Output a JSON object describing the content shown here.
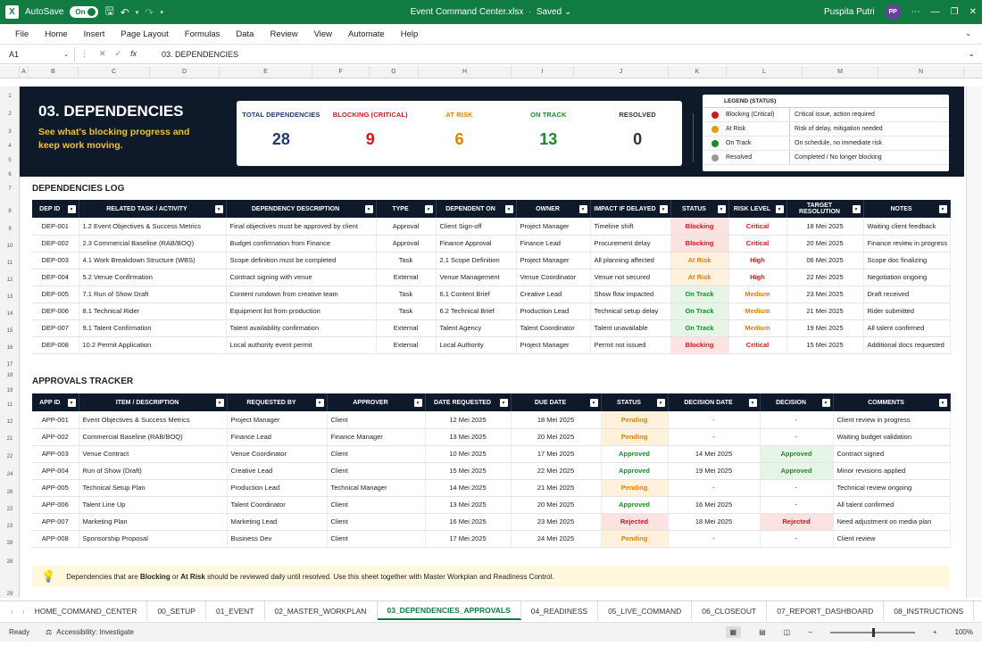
{
  "title_bar": {
    "autosave": "AutoSave",
    "toggle": "On",
    "filename": "Event Command Center.xlsx",
    "saved": "Saved",
    "user": "Puspita Putri",
    "initials": "PP"
  },
  "menu": [
    "File",
    "Home",
    "Insert",
    "Page Layout",
    "Formulas",
    "Data",
    "Review",
    "View",
    "Automate",
    "Help"
  ],
  "formula": {
    "cell": "A1",
    "value": "03. DEPENDENCIES"
  },
  "columns": [
    "A",
    "B",
    "C",
    "D",
    "E",
    "F",
    "G",
    "H",
    "I",
    "J",
    "K",
    "L",
    "M",
    "N"
  ],
  "rows": [
    "1",
    "2",
    "3",
    "4",
    "5",
    "6",
    "7",
    "8",
    "9",
    "10",
    "11",
    "12",
    "13",
    "14",
    "15",
    "16",
    "17",
    "18",
    "19",
    "11",
    "12",
    "21",
    "22",
    "24",
    "26",
    "22",
    "23",
    "28",
    "28",
    "29"
  ],
  "banner": {
    "title": "03. DEPENDENCIES",
    "subtitle": "See what's blocking progress and keep work moving.",
    "kpis": [
      {
        "label": "TOTAL DEPENDENCIES",
        "value": "28",
        "color": "#1f3a7a"
      },
      {
        "label": "BLOCKING (CRITICAL)",
        "value": "9",
        "color": "#d01818"
      },
      {
        "label": "AT RISK",
        "value": "6",
        "color": "#e07f00"
      },
      {
        "label": "ON TRACK",
        "value": "13",
        "color": "#1c8a2a"
      },
      {
        "label": "RESOLVED",
        "value": "0",
        "color": "#333333"
      }
    ]
  },
  "legend": {
    "title": "LEGEND (STATUS)",
    "items": [
      {
        "name": "Blocking (Critical)",
        "desc": "Critical issue, action required",
        "color": "#d01818"
      },
      {
        "name": "At Risk",
        "desc": "Risk of delay, mitigation needed",
        "color": "#e89a00"
      },
      {
        "name": "On Track",
        "desc": "On schedule, no immediate risk",
        "color": "#1c8a2a"
      },
      {
        "name": "Resolved",
        "desc": "Completed / No longer blocking",
        "color": "#9a9a9a"
      }
    ]
  },
  "dependencies": {
    "title": "DEPENDENCIES LOG",
    "headers": [
      "DEP ID",
      "RELATED TASK / ACTIVITY",
      "DEPENDENCY DESCRIPTION",
      "TYPE",
      "DEPENDENT ON",
      "OWNER",
      "IMPACT IF DELAYED",
      "STATUS",
      "RISK LEVEL",
      "TARGET RESOLUTION",
      "NOTES"
    ],
    "rows": [
      [
        "DEP-001",
        "1.2 Event Objectives & Success Metrics",
        "Final objectives must be approved by client",
        "Approval",
        "Client Sign-off",
        "Project Manager",
        "Timeline shift",
        "Blocking",
        "Critical",
        "18 Mei 2025",
        "Waiting client feedback"
      ],
      [
        "DEP-002",
        "2.3 Commercial Baseline (RAB/BOQ)",
        "Budget confirmation from Finance",
        "Approval",
        "Finance Approval",
        "Finance Lead",
        "Procurement delay",
        "Blocking",
        "Critical",
        "20 Mei 2025",
        "Finance review in progress"
      ],
      [
        "DEP-003",
        "4.1 Work Breakdown Structure (WBS)",
        "Scope definition must be completed",
        "Task",
        "2.1 Scope Definition",
        "Project Manager",
        "All planning affected",
        "At Risk",
        "High",
        "06 Mei 2025",
        "Scope doc finalizing"
      ],
      [
        "DEP-004",
        "5.2 Venue Confirmation",
        "Contract signing with venue",
        "External",
        "Venue Management",
        "Venue Coordinator",
        "Venue not secured",
        "At Risk",
        "High",
        "22 Mei 2025",
        "Negotiation ongoing"
      ],
      [
        "DEP-005",
        "7.1 Run of Show Draft",
        "Content rundown from creative team",
        "Task",
        "6.1 Content Brief",
        "Creative Lead",
        "Show flow impacted",
        "On Track",
        "Medium",
        "23 Mei 2025",
        "Draft received"
      ],
      [
        "DEP-006",
        "8.1 Technical Rider",
        "Equipment list from production",
        "Task",
        "6.2 Technical Brief",
        "Production Lead",
        "Technical setup delay",
        "On Track",
        "Medium",
        "21 Mei 2025",
        "Rider submitted"
      ],
      [
        "DEP-007",
        "9.1 Talent Confirmation",
        "Talent availability confirmation",
        "External",
        "Talent Agency",
        "Talent Coordinator",
        "Talent unavailable",
        "On Track",
        "Medium",
        "19 Mei 2025",
        "All talent confirmed"
      ],
      [
        "DEP-008",
        "10.2 Permit Application",
        "Local authority event permit",
        "External",
        "Local Authority",
        "Project Manager",
        "Permit not issued",
        "Blocking",
        "Critical",
        "15 Mei 2025",
        "Additional docs requested"
      ]
    ]
  },
  "approvals": {
    "title": "APPROVALS TRACKER",
    "headers": [
      "APP ID",
      "ITEM / DESCRIPTION",
      "REQUESTED BY",
      "APPROVER",
      "DATE REQUESTED",
      "DUE DATE",
      "STATUS",
      "DECISION DATE",
      "DECISION",
      "COMMENTS"
    ],
    "rows": [
      [
        "APP-001",
        "Event Objectives & Success Metrics",
        "Project Manager",
        "Client",
        "12 Mei 2025",
        "18 Mei 2025",
        "Pending",
        "-",
        "-",
        "Client review in progress"
      ],
      [
        "APP-002",
        "Commercial Baseline (RAB/BOQ)",
        "Finance Lead",
        "Finance Manager",
        "13 Mei 2025",
        "20 Mei 2025",
        "Pending",
        "-",
        "-",
        "Waiting budget validation"
      ],
      [
        "APP-003",
        "Venue Contract",
        "Venue Coordinator",
        "Client",
        "10 Mei 2025",
        "17 Mei 2025",
        "Approved",
        "14 Mei 2025",
        "Approved",
        "Contract signed"
      ],
      [
        "APP-004",
        "Run of Show (Draft)",
        "Creative Lead",
        "Client",
        "15 Mei 2025",
        "22 Mei 2025",
        "Approved",
        "19 Mei 2025",
        "Approved",
        "Minor revisions applied"
      ],
      [
        "APP-005",
        "Technical Setup Plan",
        "Production Lead",
        "Technical Manager",
        "14 Mei 2025",
        "21 Mei 2025",
        "Pending",
        "-",
        "-",
        "Technical review ongoing"
      ],
      [
        "APP-006",
        "Talent Line Up",
        "Talent Coordinator",
        "Client",
        "13 Mei 2025",
        "20 Mei 2025",
        "Approved",
        "16 Mei 2025",
        "-",
        "All talent confirmed"
      ],
      [
        "APP-007",
        "Marketing Plan",
        "Marketing Lead",
        "Client",
        "16 Mei 2025",
        "23 Mei 2025",
        "Rejected",
        "18 Mei 2025",
        "Rejected",
        "Need adjustment on media plan"
      ],
      [
        "APP-008",
        "Sponsorship Proposal",
        "Business Dev",
        "Client",
        "17 Mei 2025",
        "24 Mei 2025",
        "Pending",
        "-",
        "-",
        "Client review"
      ]
    ]
  },
  "note": {
    "before": "Dependencies that are ",
    "b1": "Blocking",
    "mid": " or ",
    "b2": "At Risk",
    "after": " should be reviewed daily until resolved. Use this sheet together with Master Workplan and Readiness Control."
  },
  "tabs": [
    "HOME_COMMAND_CENTER",
    "00_SETUP",
    "01_EVENT",
    "02_MASTER_WORKPLAN",
    "03_DEPENDENCIES_APPROVALS",
    "04_READINESS",
    "05_LIVE_COMMAND",
    "06_CLOSEOUT",
    "07_REPORT_DASHBOARD",
    "08_INSTRUCTIONS"
  ],
  "active_tab": "03_DEPENDENCIES_APPROVALS",
  "status_bar": {
    "ready": "Ready",
    "accessibility": "Accessibility: Investigate",
    "zoom": "100%"
  }
}
